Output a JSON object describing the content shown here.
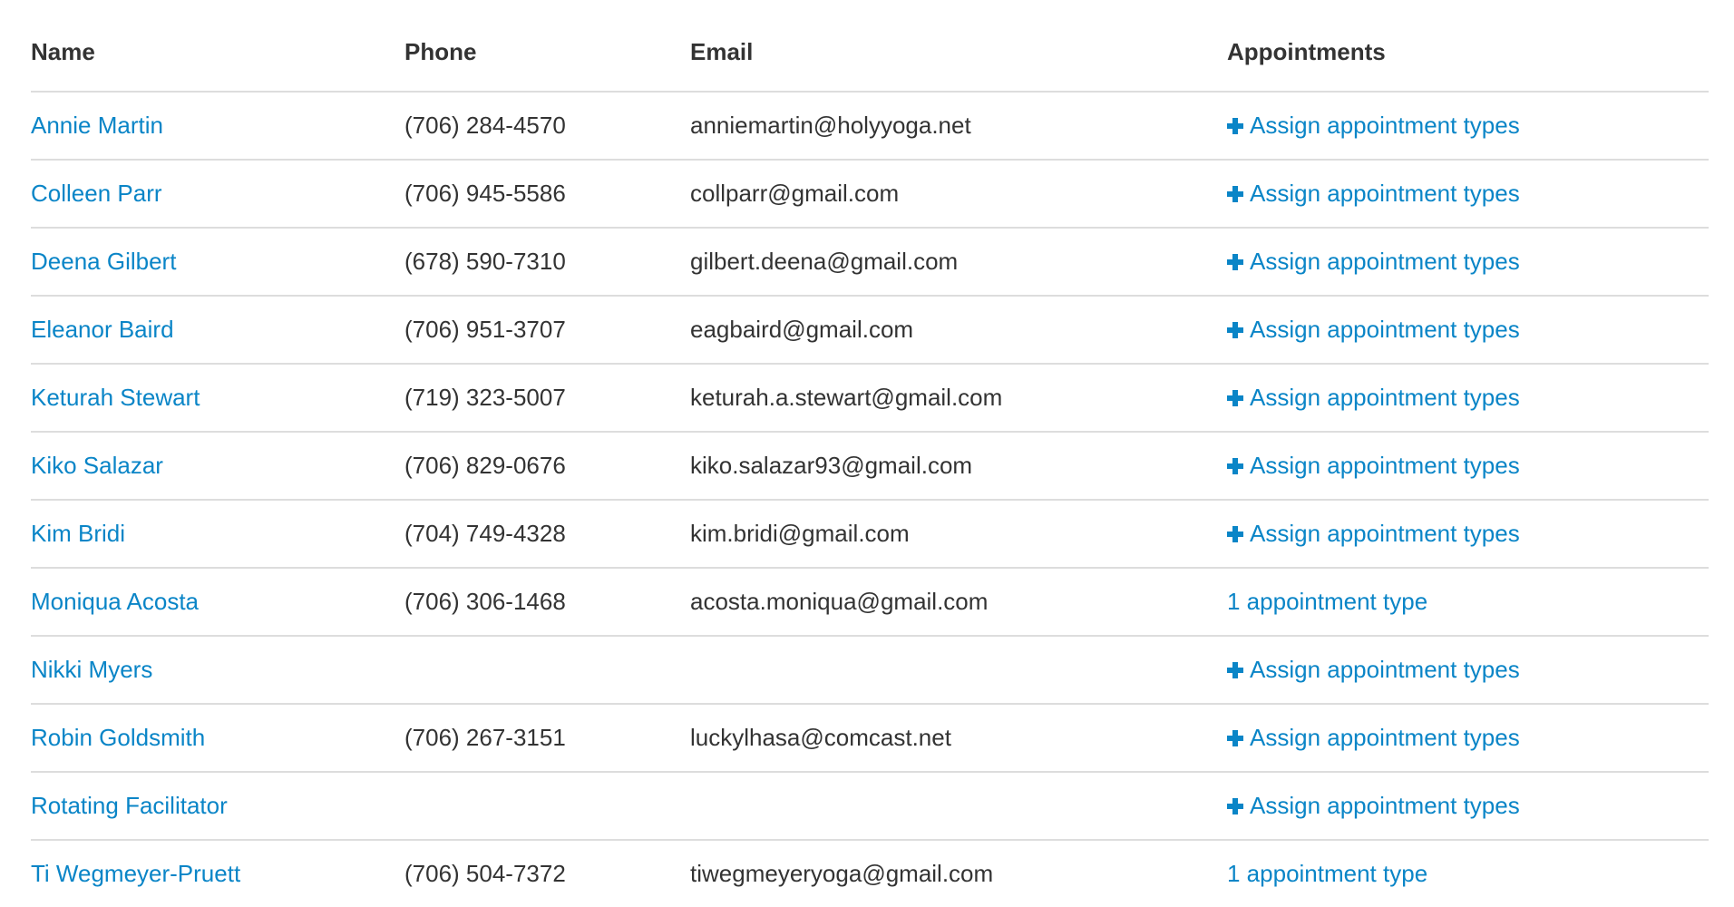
{
  "table": {
    "headers": {
      "name": "Name",
      "phone": "Phone",
      "email": "Email",
      "appointments": "Appointments"
    },
    "rows": [
      {
        "name": "Annie Martin",
        "phone": "(706) 284-4570",
        "email": "anniemartin@holyyoga.net",
        "appointments": "Assign appointment types",
        "has_plus": true
      },
      {
        "name": "Colleen Parr",
        "phone": "(706) 945-5586",
        "email": "collparr@gmail.com",
        "appointments": "Assign appointment types",
        "has_plus": true
      },
      {
        "name": "Deena Gilbert",
        "phone": "(678) 590-7310",
        "email": "gilbert.deena@gmail.com",
        "appointments": "Assign appointment types",
        "has_plus": true
      },
      {
        "name": "Eleanor Baird",
        "phone": "(706) 951-3707",
        "email": "eagbaird@gmail.com",
        "appointments": "Assign appointment types",
        "has_plus": true
      },
      {
        "name": "Keturah Stewart",
        "phone": "(719) 323-5007",
        "email": "keturah.a.stewart@gmail.com",
        "appointments": "Assign appointment types",
        "has_plus": true
      },
      {
        "name": "Kiko Salazar",
        "phone": "(706) 829-0676",
        "email": "kiko.salazar93@gmail.com",
        "appointments": "Assign appointment types",
        "has_plus": true
      },
      {
        "name": "Kim Bridi",
        "phone": "(704) 749-4328",
        "email": "kim.bridi@gmail.com",
        "appointments": "Assign appointment types",
        "has_plus": true
      },
      {
        "name": "Moniqua Acosta",
        "phone": "(706) 306-1468",
        "email": "acosta.moniqua@gmail.com",
        "appointments": "1 appointment type",
        "has_plus": false
      },
      {
        "name": "Nikki Myers",
        "phone": "",
        "email": "",
        "appointments": "Assign appointment types",
        "has_plus": true
      },
      {
        "name": "Robin Goldsmith",
        "phone": "(706) 267-3151",
        "email": "luckylhasa@comcast.net",
        "appointments": "Assign appointment types",
        "has_plus": true
      },
      {
        "name": "Rotating Facilitator",
        "phone": "",
        "email": "",
        "appointments": "Assign appointment types",
        "has_plus": true
      },
      {
        "name": "Ti Wegmeyer-Pruett",
        "phone": "(706) 504-7372",
        "email": "tiwegmeyeryoga@gmail.com",
        "appointments": "1 appointment type",
        "has_plus": false
      }
    ]
  },
  "colors": {
    "link": "#0a85c7",
    "text": "#333333",
    "border": "#dddddd"
  },
  "icons": {
    "assign": "plus-icon"
  }
}
